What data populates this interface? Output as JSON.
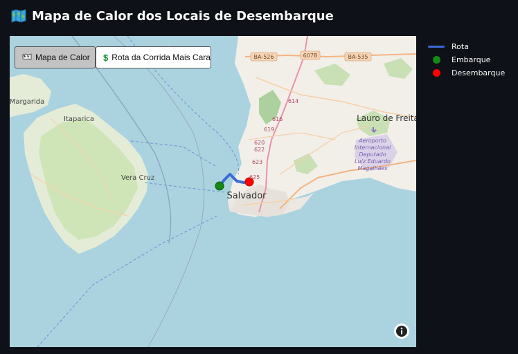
{
  "header": {
    "title": "Mapa de Calor dos Locais de Desembarque",
    "icon": "map-icon"
  },
  "map": {
    "toggles": [
      {
        "label": "Mapa de Calor",
        "icon": "world-map-icon",
        "active": true
      },
      {
        "label": "Rota da Corrida Mais Cara",
        "icon": "dollar-icon",
        "active": false
      }
    ],
    "place_labels": {
      "salvador": "Salvador",
      "itaparica": "Itaparica",
      "vera_cruz": "Vera Cruz",
      "margarida": "Margarida",
      "lauro": "Lauro de Freita",
      "airport1": "Aeroporto",
      "airport2": "Internacional",
      "airport3": "Deputado",
      "airport4": "Luiz Eduardo",
      "airport5": "Magalhães"
    },
    "road_shields": {
      "ba526": "BA-526",
      "b607": "607B",
      "ba535": "BA-535"
    },
    "road_numbers": {
      "r614": "614",
      "r616": "616",
      "r619": "619",
      "r620": "620",
      "r622": "622",
      "r623": "623",
      "r625": "625"
    },
    "info_icon": "info-icon"
  },
  "legend": {
    "items": [
      {
        "label": "Rota",
        "color": "#3a6bd6",
        "symbol": "line"
      },
      {
        "label": "Embarque",
        "color": "#138a13",
        "symbol": "dot"
      },
      {
        "label": "Desembarque",
        "color": "#ff0000",
        "symbol": "dot"
      }
    ]
  }
}
